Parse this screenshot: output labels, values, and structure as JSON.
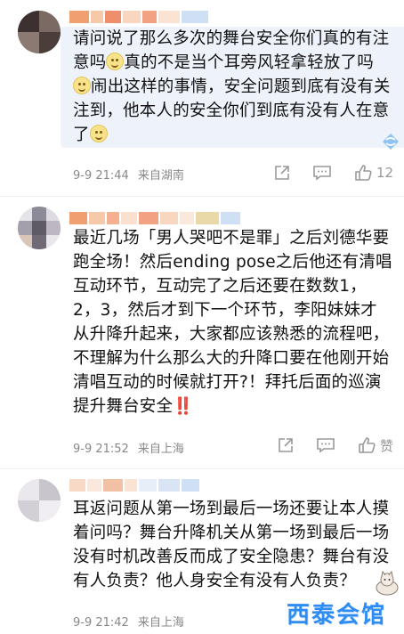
{
  "comments": [
    {
      "text_parts": [
        "请问说了那么多次的舞台安全你们真的有注意吗",
        "真的不是当个耳旁风轻拿轻放了吗",
        "闹出这样的事情，安全问题到底有没有关注到，他本人的安全你们到底有没有人在意了"
      ],
      "time": "9-9 21:44",
      "location": "来自湖南",
      "likes": "12"
    },
    {
      "text": "最近几场「男人哭吧不是罪」之后刘德华要跑全场！然后ending pose之后他还有清唱互动环节，互动完了之后还要在数数1，2，3，然后才到下一个环节，李阳妹妹才从升降升起来，大家都应该熟悉的流程吧，不理解为什么那么大的升降口要在他刚开始清唱互动的时候就打开?！拜托后面的巡演提升舞台安全",
      "bang": "‼️",
      "time": "9-9 21:52",
      "location": "来自上海",
      "likes": "赞"
    },
    {
      "text": "耳返问题从第一场到最后一场还要让本人摸着问吗？舞台升降机关从第一场到最后一场没有时机改善反而成了安全隐患？舞台有没有人负责？他人身安全有没有人负责？",
      "time": "9-9 21:42",
      "location": "来自上海"
    }
  ],
  "icons": {
    "share": "share-icon",
    "comment": "comment-icon",
    "like": "like-icon",
    "quote": "quote-badge-icon"
  },
  "watermark": "西泰会馆",
  "colors": {
    "bubble": "#eef3fb",
    "meta": "#888888",
    "accent": "#2f8cf2",
    "bang": "#e0251b"
  }
}
